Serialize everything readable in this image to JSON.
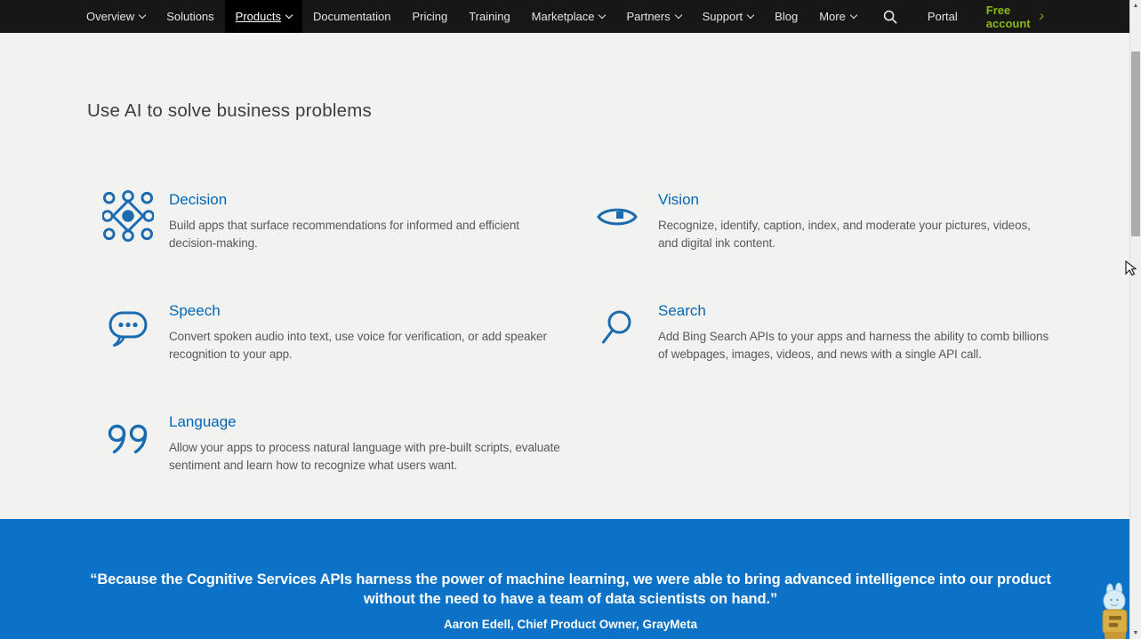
{
  "nav": {
    "items": [
      {
        "label": "Overview",
        "chevron": true,
        "active": false
      },
      {
        "label": "Solutions",
        "chevron": false,
        "active": false
      },
      {
        "label": "Products",
        "chevron": true,
        "active": true
      },
      {
        "label": "Documentation",
        "chevron": false,
        "active": false
      },
      {
        "label": "Pricing",
        "chevron": false,
        "active": false
      },
      {
        "label": "Training",
        "chevron": false,
        "active": false
      },
      {
        "label": "Marketplace",
        "chevron": true,
        "active": false
      },
      {
        "label": "Partners",
        "chevron": true,
        "active": false
      },
      {
        "label": "Support",
        "chevron": true,
        "active": false
      },
      {
        "label": "Blog",
        "chevron": false,
        "active": false
      },
      {
        "label": "More",
        "chevron": true,
        "active": false
      }
    ],
    "search_icon": "search-icon",
    "portal_label": "Portal",
    "free_account_label": "Free account"
  },
  "main": {
    "heading": "Use AI to solve business problems",
    "features": [
      {
        "title": "Decision",
        "icon": "decision-icon",
        "description": "Build apps that surface recommendations for informed and efficient decision-making."
      },
      {
        "title": "Vision",
        "icon": "vision-icon",
        "description": "Recognize, identify, caption, index, and moderate your pictures, videos, and digital ink content."
      },
      {
        "title": "Speech",
        "icon": "speech-icon",
        "description": "Convert spoken audio into text, use voice for verification, or add speaker recognition to your app."
      },
      {
        "title": "Search",
        "icon": "search-feature-icon",
        "description": "Add Bing Search APIs to your apps and harness the ability to comb billions of webpages, images, videos, and news with a single API call."
      },
      {
        "title": "Language",
        "icon": "language-icon",
        "description": "Allow your apps to process natural language with pre-built scripts, evaluate sentiment and learn how to recognize what users want."
      }
    ]
  },
  "quote_band": {
    "quote_line1": "“Because the Cognitive Services APIs harness the power of machine learning, we were able to bring advanced intelligence into our product",
    "quote_line2": "without the need to have a team of data scientists on hand.”",
    "attribution": "Aaron Edell, Chief Product Owner, GrayMeta"
  },
  "colors": {
    "nav_background": "#171717",
    "nav_active_background": "#000000",
    "band_blue": "#0b72c8",
    "link_blue": "#0067b8",
    "icon_blue": "#1b6bb1",
    "free_account_green": "#8ab812",
    "page_background": "#f2f2f0"
  }
}
